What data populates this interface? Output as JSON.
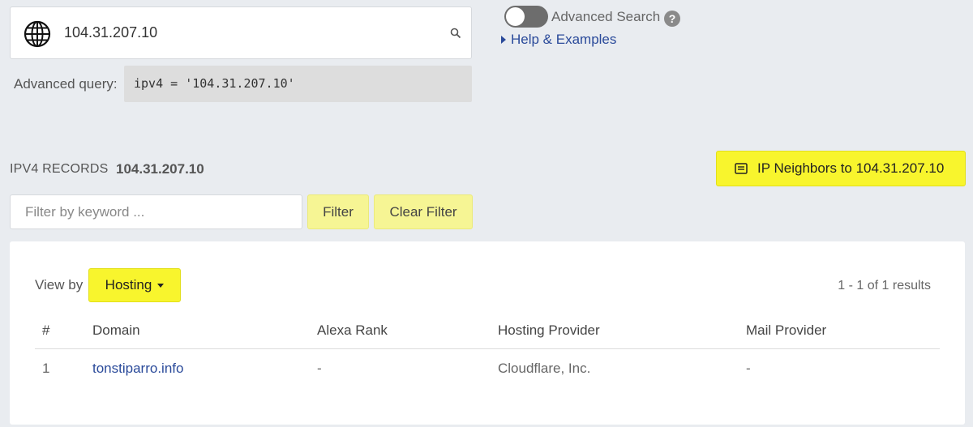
{
  "search": {
    "value": "104.31.207.10",
    "advanced_label": "Advanced query:",
    "advanced_query": "ipv4 = '104.31.207.10'"
  },
  "advanced": {
    "toggle_label": "Advanced Search",
    "help_glyph": "?",
    "help_link": "Help & Examples"
  },
  "records": {
    "heading": "IPV4 RECORDS",
    "ip": "104.31.207.10",
    "neighbors_button": "IP Neighbors to 104.31.207.10"
  },
  "filter": {
    "placeholder": "Filter by keyword ...",
    "filter_button": "Filter",
    "clear_button": "Clear Filter"
  },
  "results": {
    "view_by_label": "View by",
    "view_by_value": "Hosting",
    "count": "1 - 1 of 1 results",
    "columns": [
      "#",
      "Domain",
      "Alexa Rank",
      "Hosting Provider",
      "Mail Provider"
    ],
    "rows": [
      {
        "num": "1",
        "domain": "tonstiparro.info",
        "alexa": "-",
        "hosting": "Cloudflare, Inc.",
        "mail": "-"
      }
    ]
  },
  "colors": {
    "accent_yellow": "#f8f52d",
    "soft_yellow": "#f6f594",
    "link_blue": "#2a4a9a",
    "background": "#e9ecf0"
  }
}
